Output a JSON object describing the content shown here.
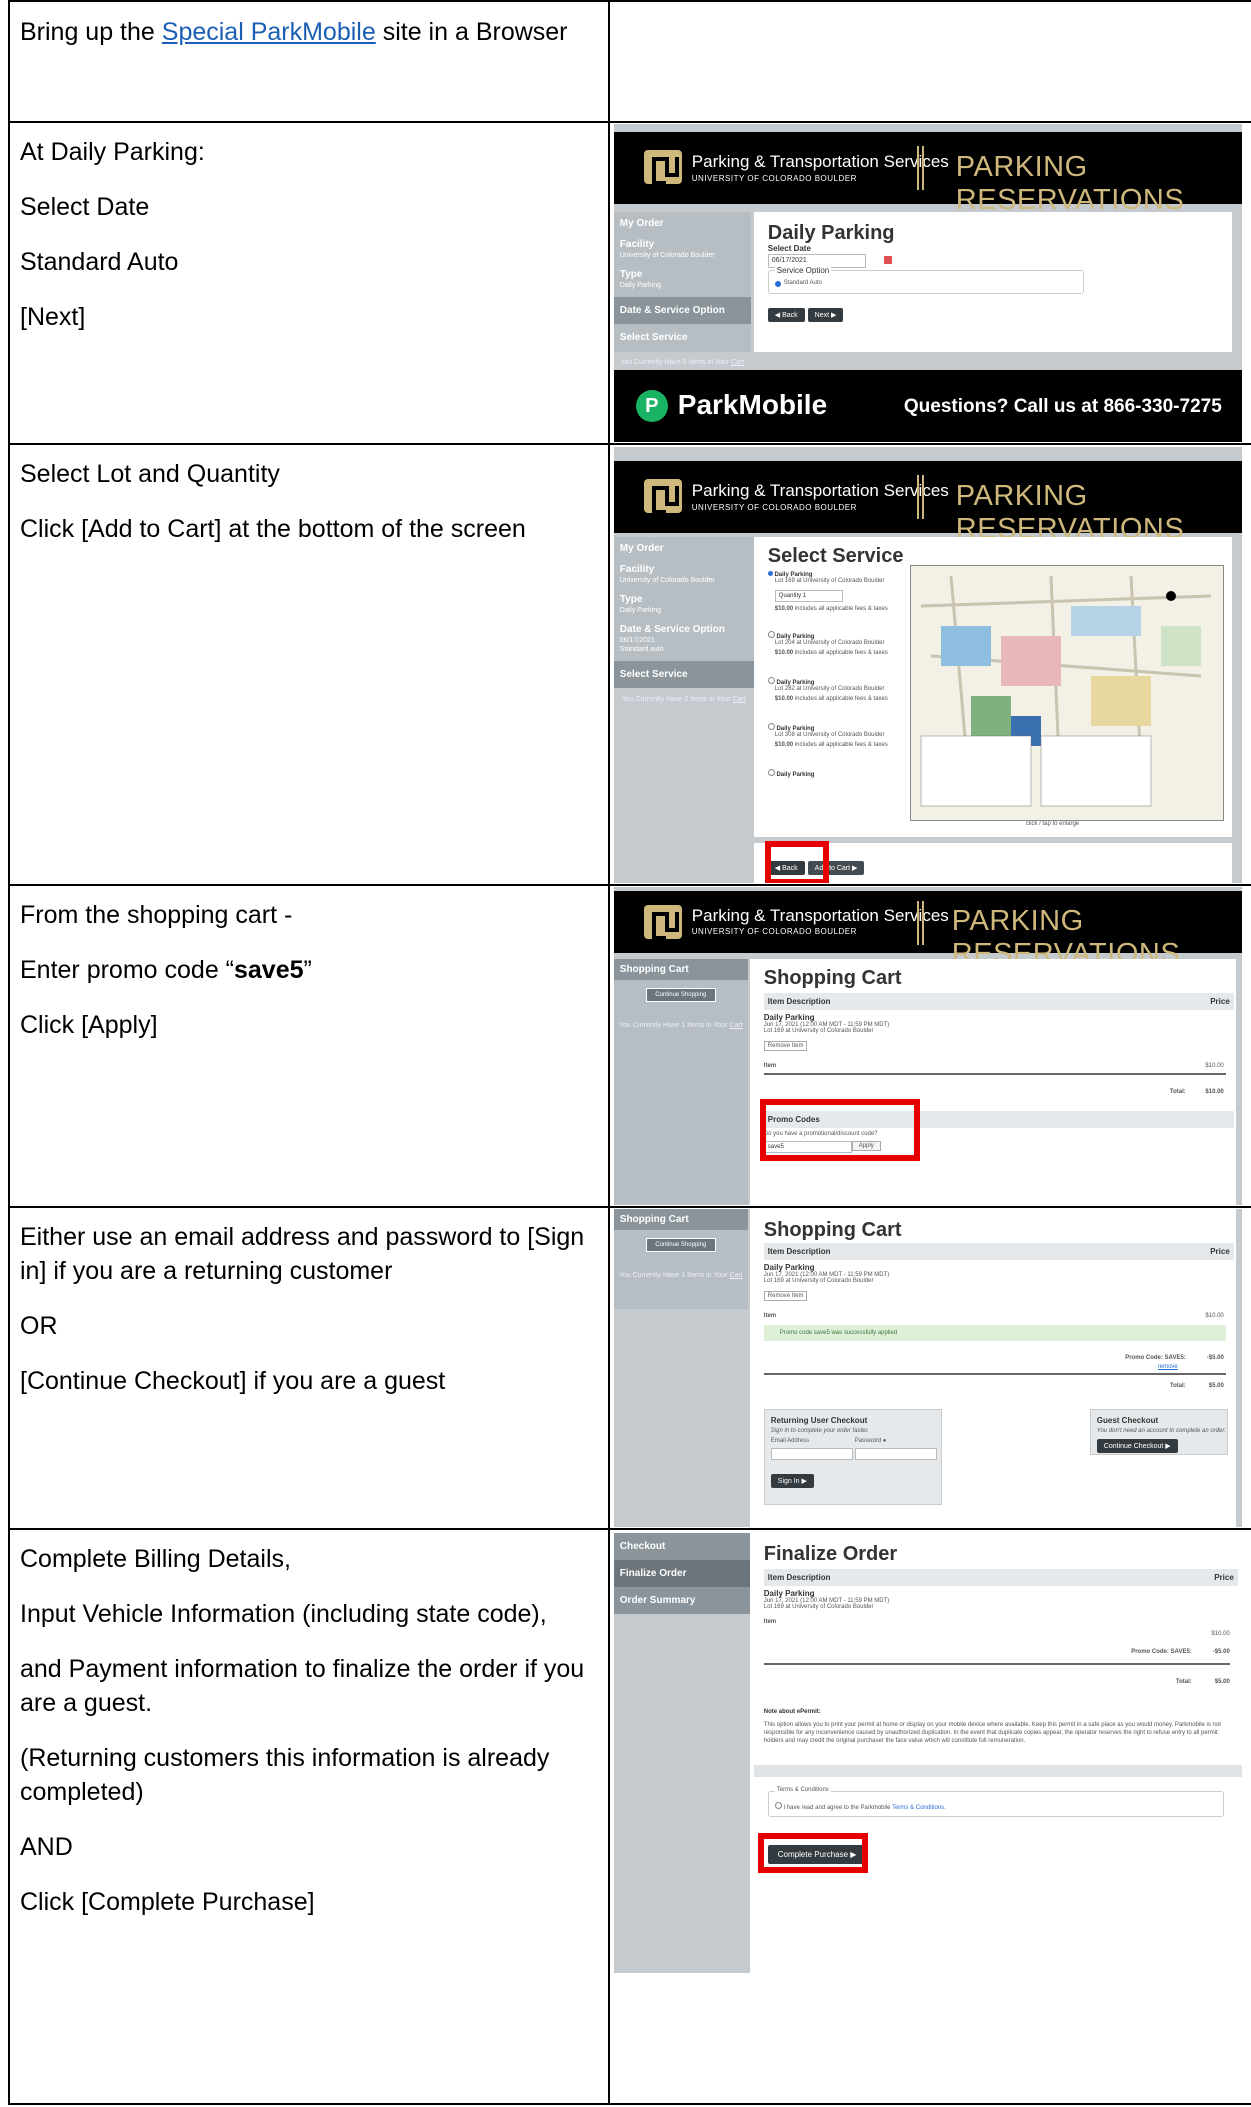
{
  "rows": [
    {
      "paragraphs": [
        "Bring up the ",
        "Special ParkMobile",
        " site in a Browser"
      ]
    },
    {
      "paragraphs": [
        "At Daily Parking:",
        "Select Date",
        "Standard Auto",
        "[Next]"
      ]
    },
    {
      "paragraphs": [
        "Select Lot and Quantity",
        "Click [Add to Cart] at the bottom of the screen"
      ]
    },
    {
      "paragraphs": [
        "From the shopping cart -",
        "Enter promo code “",
        "save5",
        "”",
        "Click [Apply]"
      ]
    },
    {
      "paragraphs": [
        "Either use an email address and password to [Sign in] if you are a returning customer",
        "OR",
        "[Continue Checkout] if you are a guest"
      ]
    },
    {
      "paragraphs": [
        "Complete Billing Details,",
        "Input Vehicle Information (including state code),",
        "and Payment information to finalize the order if you are a guest.",
        "(Returning customers this information is already completed)",
        "AND",
        "Click [Complete Purchase]"
      ]
    }
  ],
  "ui": {
    "banner_brand": "Parking & Transportation Services",
    "banner_sub": "UNIVERSITY OF COLORADO BOULDER",
    "banner_title": "PARKING RESERVATIONS",
    "pm_name": "ParkMobile",
    "pm_questions": "Questions? Call us at 866-330-7275",
    "side": {
      "my_order": "My Order",
      "facility": "Facility",
      "facility_val": "University of Colorado Boulder",
      "type": "Type",
      "type_val": "Daily Parking",
      "date_service": "Date & Service Option",
      "date_val": "06/17/2021",
      "service_val": "Standard auto",
      "select_service": "Select Service",
      "cart_note_pre": "You Currently Have 0 Items in Your ",
      "cart_note_pre1": "You Currently Have 1 Items in Your ",
      "cart_link": "Cart",
      "shopping_cart": "Shopping Cart",
      "continue_shopping": "Continue Shopping",
      "checkout": "Checkout",
      "finalize_order": "Finalize Order",
      "order_summary": "Order Summary"
    },
    "daily": {
      "title": "Daily Parking",
      "select_date": "Select Date",
      "date": "06/17/2021",
      "service_option": "Service Option",
      "standard_auto": "Standard Auto",
      "back": "◀ Back",
      "next": "Next ▶"
    },
    "select": {
      "title": "Select Service",
      "lots": [
        {
          "name": "Daily Parking",
          "lot": "Lot 169 at University of Colorado Boulder"
        },
        {
          "name": "Daily Parking",
          "lot": "Lot 204 at University of Colorado Boulder"
        },
        {
          "name": "Daily Parking",
          "lot": "Lot 282 at University of Colorado Boulder"
        },
        {
          "name": "Daily Parking",
          "lot": "Lot 308 at University of Colorado Boulder"
        },
        {
          "name": "Daily Parking",
          "lot": ""
        }
      ],
      "quantity": "Quantity  1",
      "price": "$10.00",
      "price_note": "includes all applicable fees & taxes",
      "map_caption": "click / tap to enlarge",
      "back": "◀ Back",
      "add_to_cart": "Add to Cart ▶"
    },
    "cart": {
      "title": "Shopping Cart",
      "item_desc": "Item Description",
      "price": "Price",
      "item_name": "Daily Parking",
      "item_time": "Jun 17, 2021 (12:00 AM MDT - 11:59 PM MDT)",
      "item_lot": "Lot 169 at University of Colorado Boulder",
      "remove": "Remove Item",
      "item": "Item",
      "item_price": "$10.00",
      "total": "Total:",
      "total_val": "$10.00",
      "promo_codes": "Promo Codes",
      "promo_q": "Do you have a promotional/discount code?",
      "promo_val": "save5",
      "apply": "Apply",
      "applied_msg": "Promo code save5 was successfully applied",
      "promo_line": "Promo Code: SAVE5:",
      "promo_amt": "-$5.00",
      "remove_link": "remove",
      "total_after": "$5.00",
      "returning": "Returning User Checkout",
      "returning_sub": "Sign in to complete your order faster.",
      "email": "Email Address",
      "password": "Password",
      "sign_in": "Sign In ▶",
      "guest": "Guest Checkout",
      "guest_sub": "You don't need an account to complete an order.",
      "continue_checkout": "Continue Checkout ▶"
    },
    "finalize": {
      "title": "Finalize Order",
      "item_name": "Daily Parking",
      "item_time": "Jun 17, 2021 (12:00 AM MDT - 11:59 PM MDT)",
      "item_lot": "Lot 169 at University of Colorado Boulder",
      "note_title": "Note about ePermit:",
      "note_text": "This option allows you to print your permit at home or display on your mobile device where available. Keep this permit in a safe place as you would money. Parkmobile is not responsible for any inconvenience caused by unauthorized duplication. In the event that duplicate copies appear, the operator reserves the right to refuse entry to all permit holders and may credit the original purchaser the face value which will constitute full remuneration.",
      "terms_title": "Terms & Conditions",
      "terms_text": "I have read and agree to the Parkmobile ",
      "terms_link": "Terms & Conditions.",
      "complete": "Complete Purchase ▶"
    }
  }
}
